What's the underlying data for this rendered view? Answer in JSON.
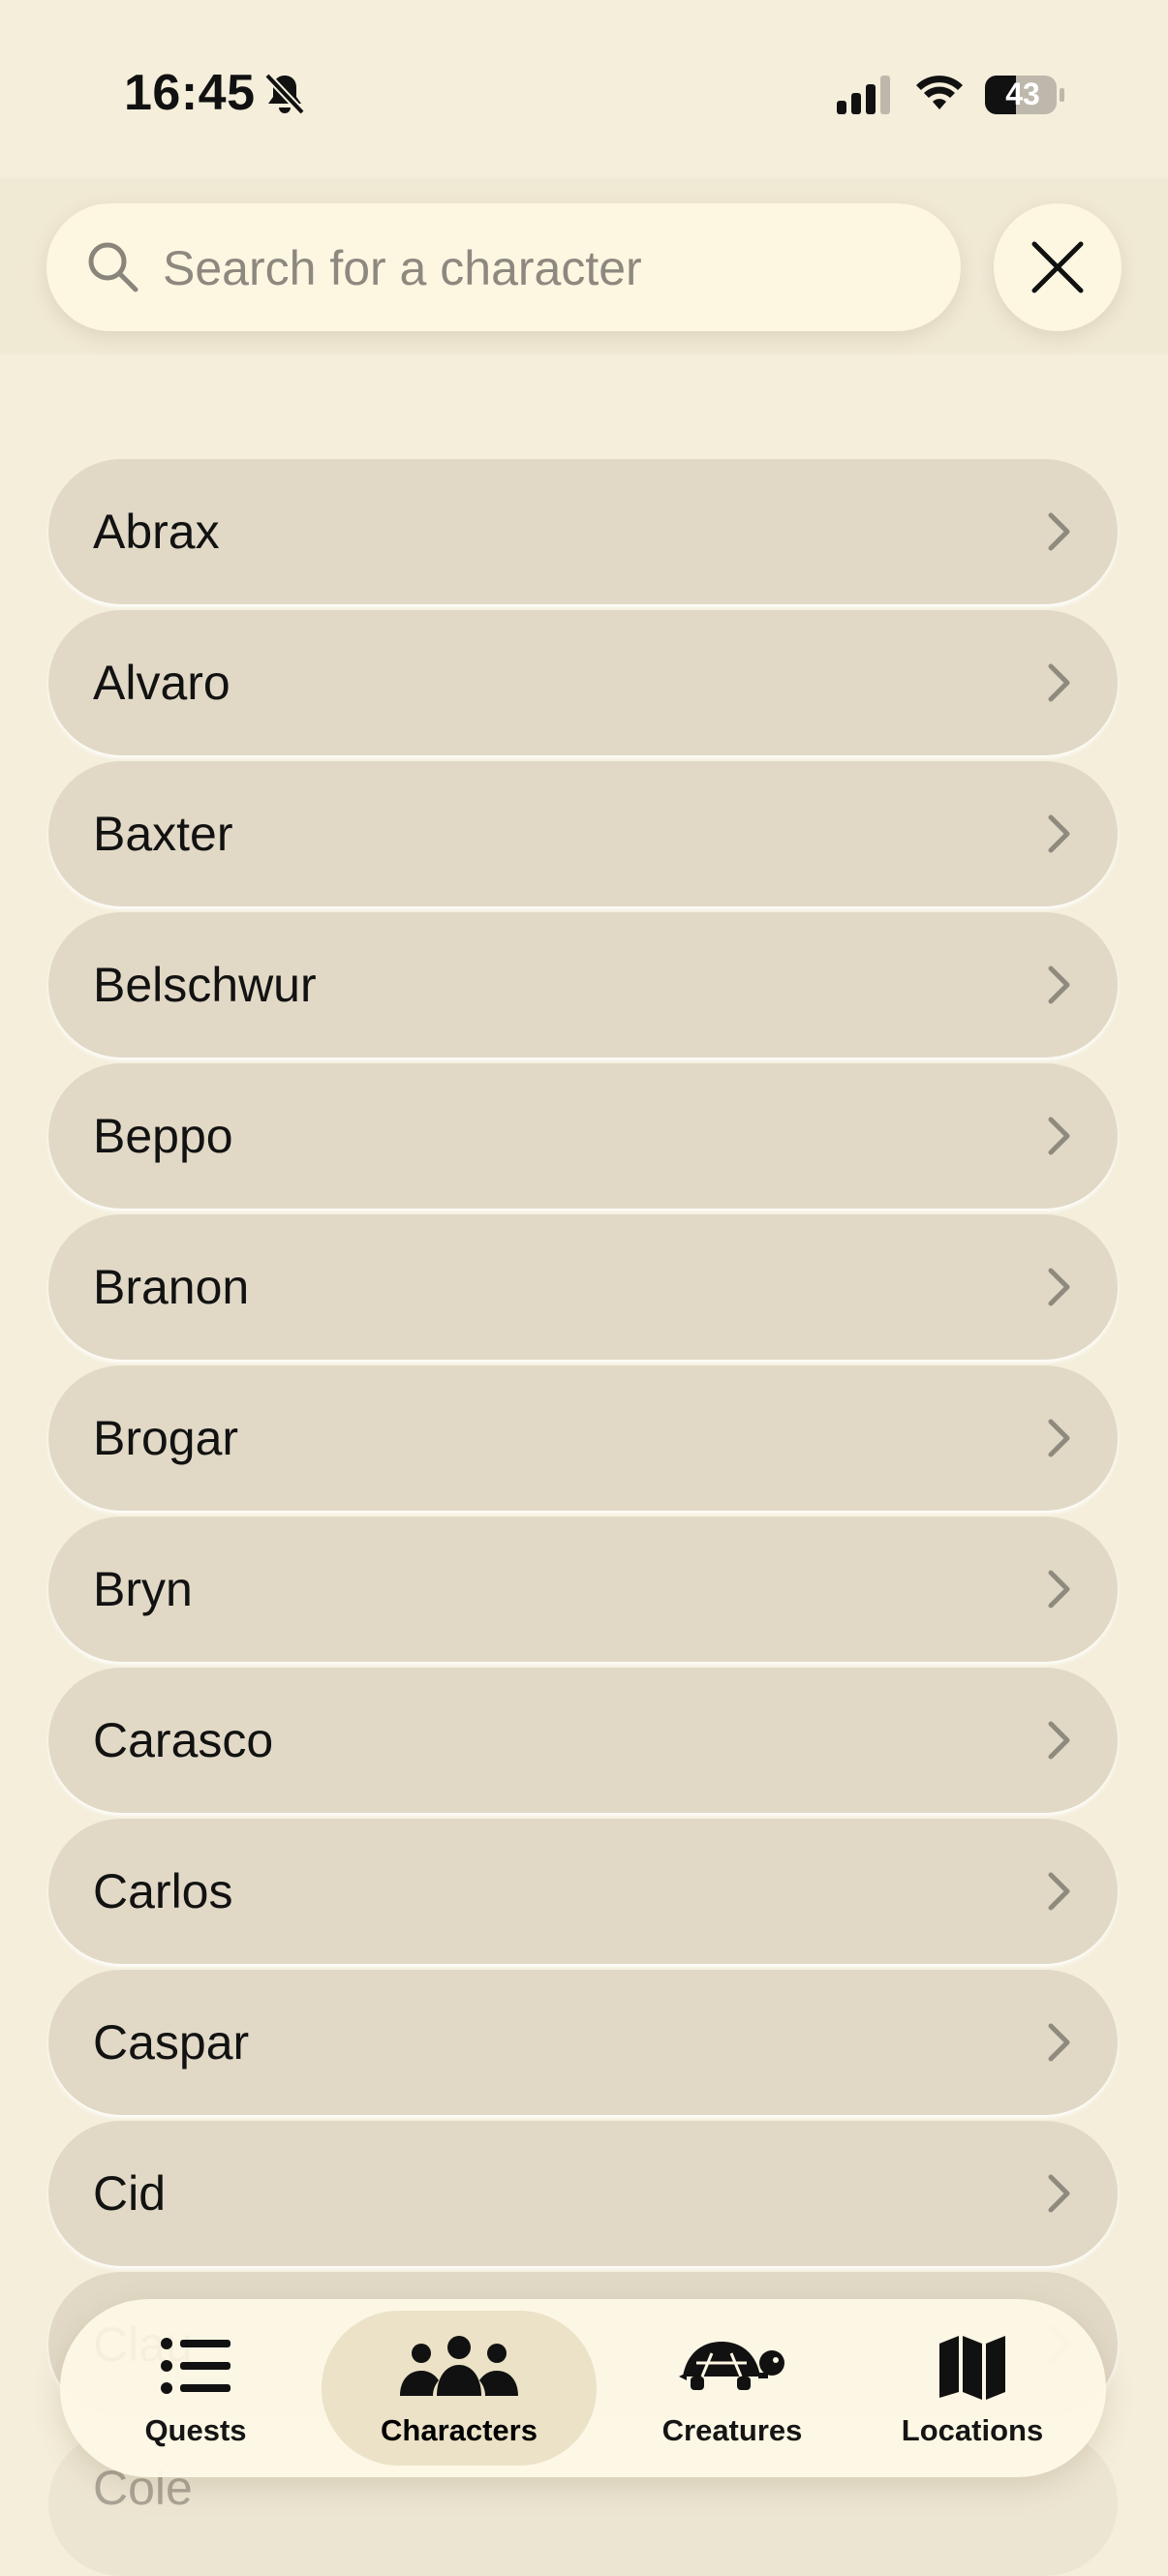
{
  "status_bar": {
    "time": "16:45",
    "battery": "43",
    "icons": [
      "bell-slash-icon",
      "signal-icon",
      "wifi-icon",
      "battery-icon"
    ]
  },
  "search": {
    "placeholder": "Search for a character",
    "value": ""
  },
  "characters": [
    {
      "name": "Abrax"
    },
    {
      "name": "Alvaro"
    },
    {
      "name": "Baxter"
    },
    {
      "name": "Belschwur"
    },
    {
      "name": "Beppo"
    },
    {
      "name": "Branon"
    },
    {
      "name": "Brogar"
    },
    {
      "name": "Bryn"
    },
    {
      "name": "Carasco"
    },
    {
      "name": "Carlos"
    },
    {
      "name": "Caspar"
    },
    {
      "name": "Cid"
    },
    {
      "name": "Clau"
    }
  ],
  "below_tab_bar": {
    "name": "Cole"
  },
  "tabs": [
    {
      "label": "Quests",
      "icon": "list-icon",
      "active": false
    },
    {
      "label": "Characters",
      "icon": "group-icon",
      "active": true
    },
    {
      "label": "Creatures",
      "icon": "turtle-icon",
      "active": false
    },
    {
      "label": "Locations",
      "icon": "map-icon",
      "active": false
    }
  ],
  "colors": {
    "background": "#f4eedb",
    "row": "#e1d9c6",
    "active_tab": "#ebe2c7"
  }
}
